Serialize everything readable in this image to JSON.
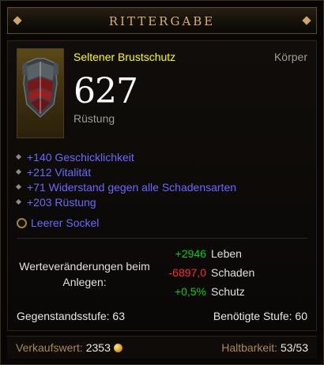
{
  "item": {
    "name": "RITTERGABE",
    "type": "Seltener Brustschutz",
    "slot": "Körper",
    "armor_value": "627",
    "armor_label": "Rüstung",
    "affixes": [
      "+140 Geschicklichkeit",
      "+212 Vitalität",
      "+71 Widerstand gegen alle Schadensarten",
      "+203 Rüstung"
    ],
    "socket_label": "Leerer Sockel"
  },
  "comparison": {
    "label": "Werteveränderungen beim Anlegen:",
    "changes": [
      {
        "value": "+2946",
        "stat": "Leben"
      },
      {
        "value": "-6897,0",
        "stat": "Schaden"
      },
      {
        "value": "+0,5%",
        "stat": "Schutz"
      }
    ]
  },
  "requirements": {
    "item_level": "Gegenstandsstufe: 63",
    "required_level": "Benötigte Stufe: 60"
  },
  "footer": {
    "sell_label": "Verkaufswert:",
    "sell_value": "2353",
    "durability_label": "Haltbarkeit:",
    "durability_value": "53/53"
  },
  "colors": {
    "title": "#d8b16c",
    "rare": "#ffff00",
    "magic_affix": "#6969ff",
    "positive": "#00d000",
    "negative": "#ff2a2a",
    "gold_label": "#a88b52"
  },
  "icons": [
    "chest-armor-icon",
    "socket-icon",
    "gold-coin-icon",
    "bullet-icon"
  ]
}
